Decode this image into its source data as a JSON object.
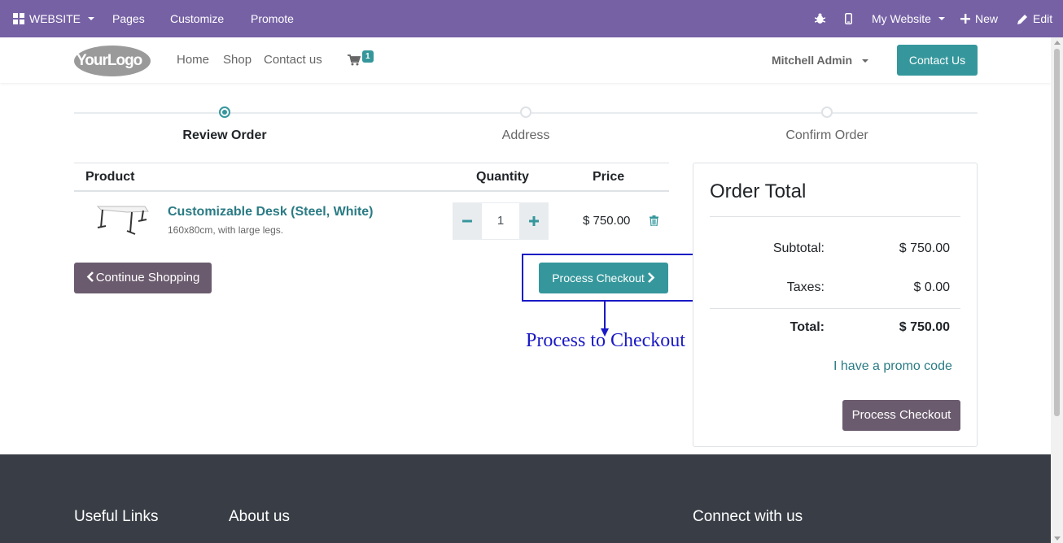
{
  "editor_bar": {
    "website": "WEBSITE",
    "pages": "Pages",
    "customize": "Customize",
    "promote": "Promote",
    "my_website": "My Website",
    "new": "New",
    "edit": "Edit"
  },
  "header": {
    "logo": "YourLogo",
    "nav": [
      "Home",
      "Shop",
      "Contact us"
    ],
    "cart_count": "1",
    "user": "Mitchell Admin",
    "contact_button": "Contact Us"
  },
  "wizard": {
    "steps": [
      "Review Order",
      "Address",
      "Confirm Order"
    ],
    "active_step": 0
  },
  "cart": {
    "headers": {
      "product": "Product",
      "quantity": "Quantity",
      "price": "Price"
    },
    "items": [
      {
        "name": "Customizable Desk (Steel, White)",
        "description": "160x80cm, with large legs.",
        "quantity": "1",
        "price": "$ 750.00"
      }
    ],
    "continue_button": "Continue Shopping",
    "checkout_button": "Process Checkout"
  },
  "annotation": {
    "text": "Process to Checkout",
    "color": "#1a19c6"
  },
  "order_total": {
    "title": "Order Total",
    "subtotal_label": "Subtotal:",
    "subtotal_value": "$ 750.00",
    "taxes_label": "Taxes:",
    "taxes_value": "$ 0.00",
    "total_label": "Total:",
    "total_value": "$ 750.00",
    "promo_link": "I have a promo code",
    "checkout_button": "Process Checkout"
  },
  "footer": {
    "headings": [
      "Useful Links",
      "About us",
      "Connect with us"
    ]
  },
  "colors": {
    "editor_bar": "#7661a5",
    "primary": "#35979c",
    "secondary": "#6b5b6e",
    "footer": "#393e46"
  }
}
